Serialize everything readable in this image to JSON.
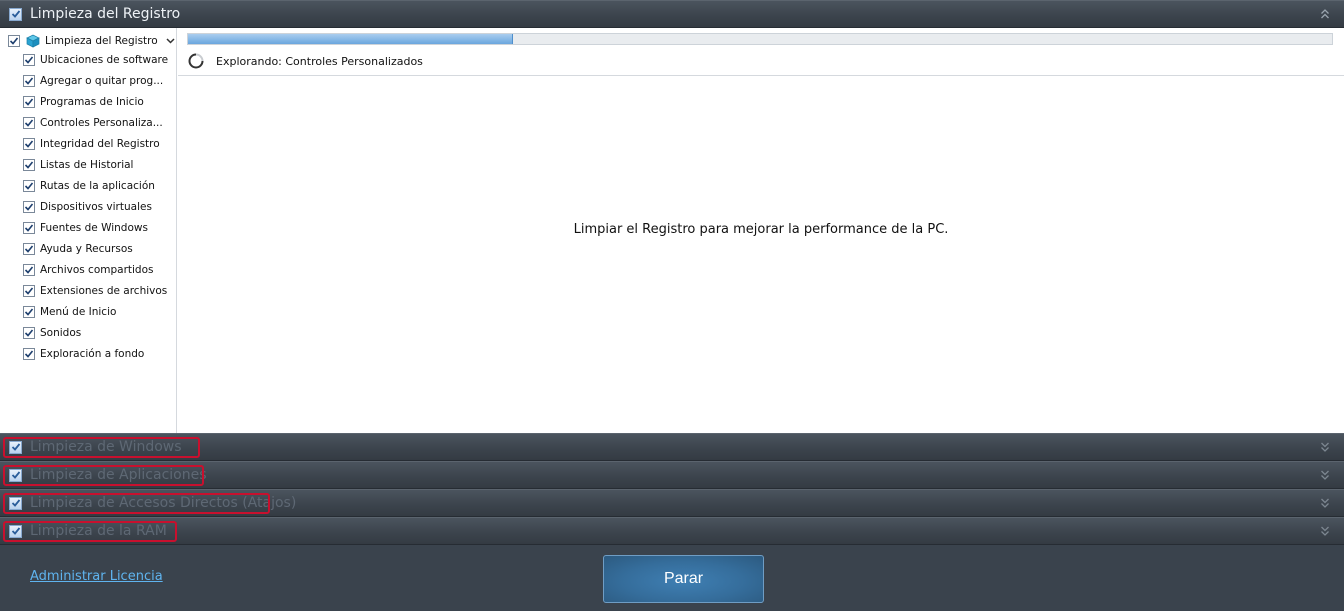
{
  "header": {
    "title": "Limpieza del Registro",
    "collapse_icon": "double-chevron-up-icon"
  },
  "tree": {
    "root_label": "Limpieza del Registro",
    "items": [
      {
        "label": "Ubicaciones de software"
      },
      {
        "label": "Agregar o quitar prog..."
      },
      {
        "label": "Programas de Inicio"
      },
      {
        "label": "Controles Personaliza..."
      },
      {
        "label": "Integridad del Registro"
      },
      {
        "label": "Listas de Historial"
      },
      {
        "label": "Rutas de la aplicación"
      },
      {
        "label": "Dispositivos virtuales"
      },
      {
        "label": "Fuentes de Windows"
      },
      {
        "label": "Ayuda y Recursos"
      },
      {
        "label": "Archivos compartidos"
      },
      {
        "label": "Extensiones de archivos"
      },
      {
        "label": "Menú de Inicio"
      },
      {
        "label": "Sonidos"
      },
      {
        "label": "Exploración a fondo"
      }
    ]
  },
  "scan": {
    "progress": 0.284,
    "status_text": "Explorando: Controles Personalizados",
    "message": "Limpiar el Registro para mejorar la performance de la PC."
  },
  "sections": [
    {
      "label": "Limpieza de Windows"
    },
    {
      "label": "Limpieza de Aplicaciones"
    },
    {
      "label": "Limpieza de Accesos Directos (Atajos)"
    },
    {
      "label": "Limpieza de la RAM"
    }
  ],
  "footer": {
    "license_link": "Administrar Licencia",
    "stop_button": "Parar"
  },
  "colors": {
    "accent": "#5fb4ef",
    "highlight": "#c8102e",
    "progress": "#6aa6de"
  }
}
